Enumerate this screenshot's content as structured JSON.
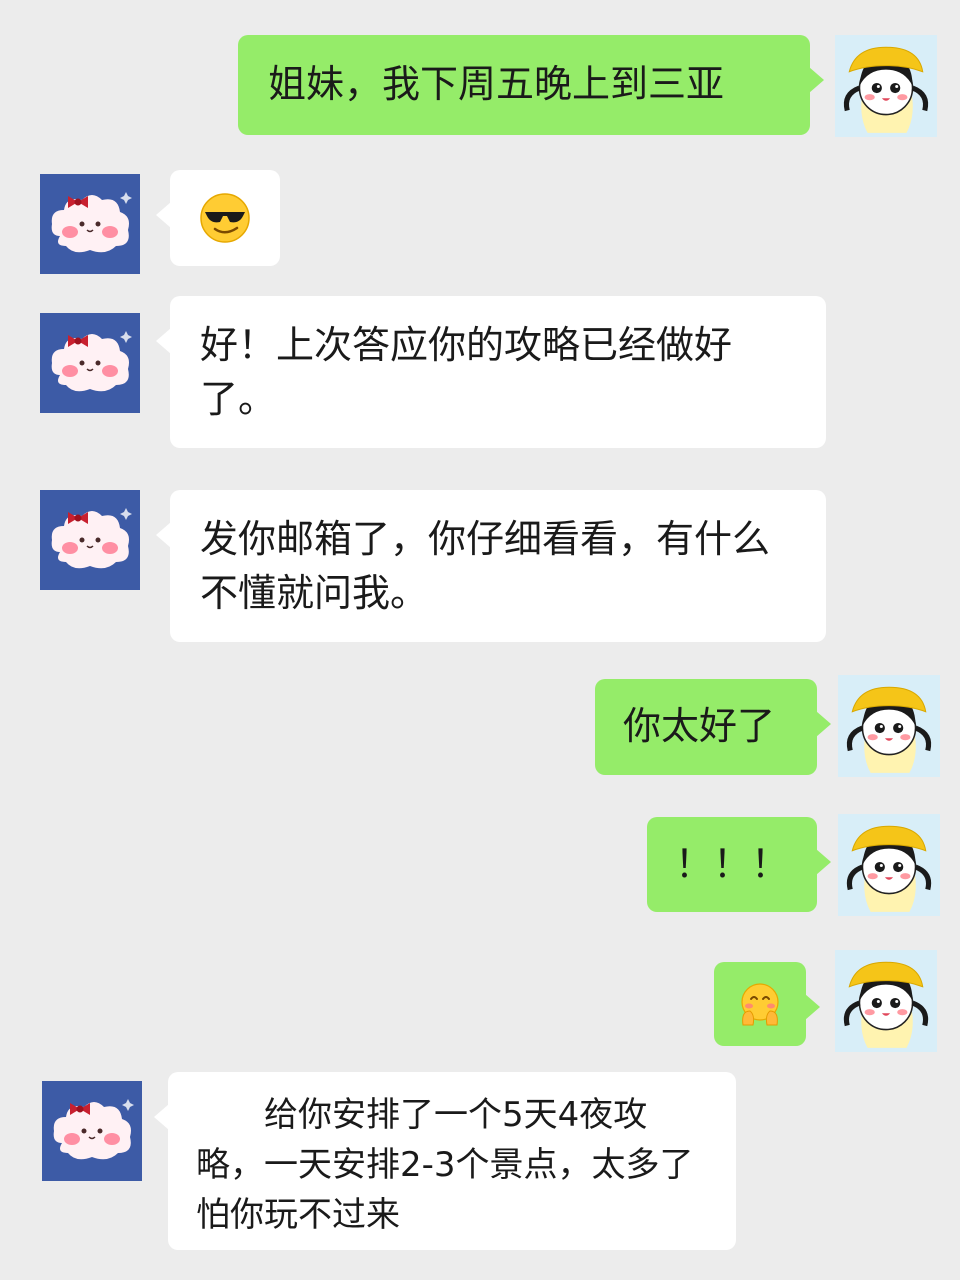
{
  "chat": {
    "colors": {
      "background": "#ececec",
      "outgoing_bubble": "#95ec69",
      "incoming_bubble": "#ffffff",
      "friend_avatar_bg": "#3d5ba6",
      "me_avatar_bg": "#d8eef8"
    },
    "messages": [
      {
        "sender": "me",
        "type": "text",
        "text": "姐妹，我下周五晚上到三亚"
      },
      {
        "sender": "friend",
        "type": "emoji",
        "emoji": "sunglasses-face"
      },
      {
        "sender": "friend",
        "type": "text",
        "text": "好！上次答应你的攻略已经做好了。"
      },
      {
        "sender": "friend",
        "type": "text",
        "text": "发你邮箱了，你仔细看看，有什么不懂就问我。"
      },
      {
        "sender": "me",
        "type": "text",
        "text": "你太好了"
      },
      {
        "sender": "me",
        "type": "text",
        "text": "！！！"
      },
      {
        "sender": "me",
        "type": "emoji",
        "emoji": "shy-smiling-face"
      },
      {
        "sender": "friend",
        "type": "text",
        "text": "给你安排了一个5天4夜攻略，一天安排2-3个景点，太多了怕你玩不过来"
      }
    ]
  }
}
